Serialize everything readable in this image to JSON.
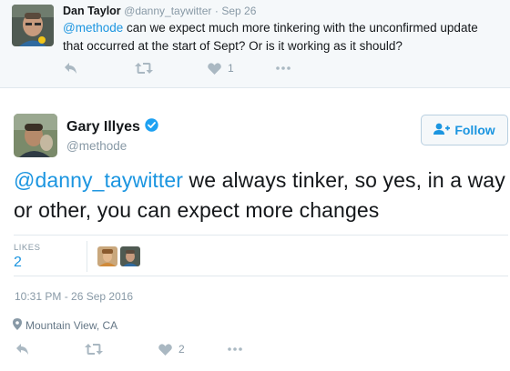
{
  "reply_tweet": {
    "author_name": "Dan Taylor",
    "handle": "@danny_taywitter",
    "separator": "·",
    "date": "Sep 26",
    "mention": "@methode",
    "text": " can we expect much more tinkering with the unconfirmed update that occurred at the start of Sept? Or is it working as it should?",
    "like_count": "1"
  },
  "main_tweet": {
    "author_name": "Gary Illyes",
    "handle": "@methode",
    "follow_label": "Follow",
    "mention": "@danny_taywitter",
    "text": " we always tinker, so yes, in a way or other, you can expect more changes",
    "likes_label": "LIKES",
    "likes_count": "2",
    "timestamp": "10:31 PM - 26 Sep 2016",
    "location": "Mountain View, CA",
    "like_count": "2"
  },
  "icons": {
    "reply": "reply-arrow-icon",
    "retweet": "retweet-icon",
    "like": "heart-icon",
    "more": "more-dots-icon",
    "verified": "verified-badge-icon",
    "follow": "add-user-icon",
    "location": "map-pin-icon"
  },
  "colors": {
    "link": "#1b95e0",
    "muted": "#8899a6",
    "icon": "#aab8c2",
    "reply_bg": "#f5f8fa",
    "border": "#e1e8ed"
  }
}
